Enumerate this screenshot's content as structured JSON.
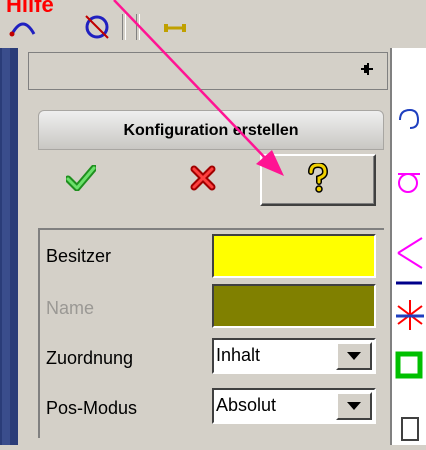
{
  "toolbar": {
    "cutoff_label": "Hilfe",
    "icons": [
      "sketch-arc-icon",
      "sketch-circle-icon",
      "sketch-dimension-icon"
    ]
  },
  "panel": {
    "pin_icon": "pin-icon",
    "title": "Konfiguration erstellen",
    "buttons": {
      "ok_icon": "green-check-icon",
      "cancel_icon": "red-x-icon",
      "help_icon": "yellow-question-icon"
    },
    "properties": [
      {
        "label": "Besitzer",
        "disabled": false,
        "kind": "color",
        "color": "#ffff00"
      },
      {
        "label": "Name",
        "disabled": true,
        "kind": "color",
        "color": "#808000"
      },
      {
        "label": "Zuordnung",
        "disabled": false,
        "kind": "select",
        "value": "Inhalt"
      },
      {
        "label": "Pos-Modus",
        "disabled": false,
        "kind": "select",
        "value": "Absolut"
      }
    ]
  },
  "colors": {
    "annotation_arrow": "#ff1493",
    "title_text": "#ff0000"
  }
}
